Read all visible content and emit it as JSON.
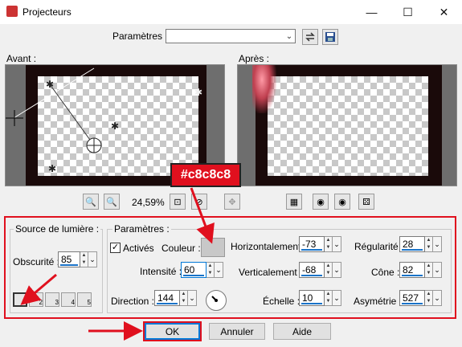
{
  "window": {
    "title": "Projecteurs",
    "minimize": "—",
    "maximize": "☐",
    "close": "✕"
  },
  "toolbar": {
    "presets_label": "Paramètres :",
    "presets_value": ""
  },
  "previews": {
    "before_label": "Avant :",
    "after_label": "Après :",
    "zoom": "24,59%"
  },
  "callout": {
    "text": "#c8c8c8",
    "color": "#c8c8c8"
  },
  "light_source": {
    "group_title": "Source de lumière :",
    "darkness_label": "Obscurité :",
    "darkness_value": "85",
    "light_buttons": [
      "1",
      "2",
      "3",
      "4",
      "5"
    ]
  },
  "params": {
    "group_title": "Paramètres :",
    "active_label": "Activés",
    "active_checked": true,
    "color_label": "Couleur :",
    "intensity_label": "Intensité :",
    "intensity_value": "60",
    "direction_label": "Direction :",
    "direction_value": "144",
    "horizontal_label": "Horizontalement :",
    "horizontal_value": "-73",
    "vertical_label": "Verticalement :",
    "vertical_value": "-68",
    "scale_label": "Échelle :",
    "scale_value": "10",
    "regularity_label": "Régularité :",
    "regularity_value": "28",
    "cone_label": "Cône :",
    "cone_value": "82",
    "asymmetry_label": "Asymétrie :",
    "asymmetry_value": "527"
  },
  "buttons": {
    "ok": "OK",
    "cancel": "Annuler",
    "help": "Aide"
  },
  "colors": {
    "accent": "#0078d7",
    "annotation": "#e0101e"
  }
}
